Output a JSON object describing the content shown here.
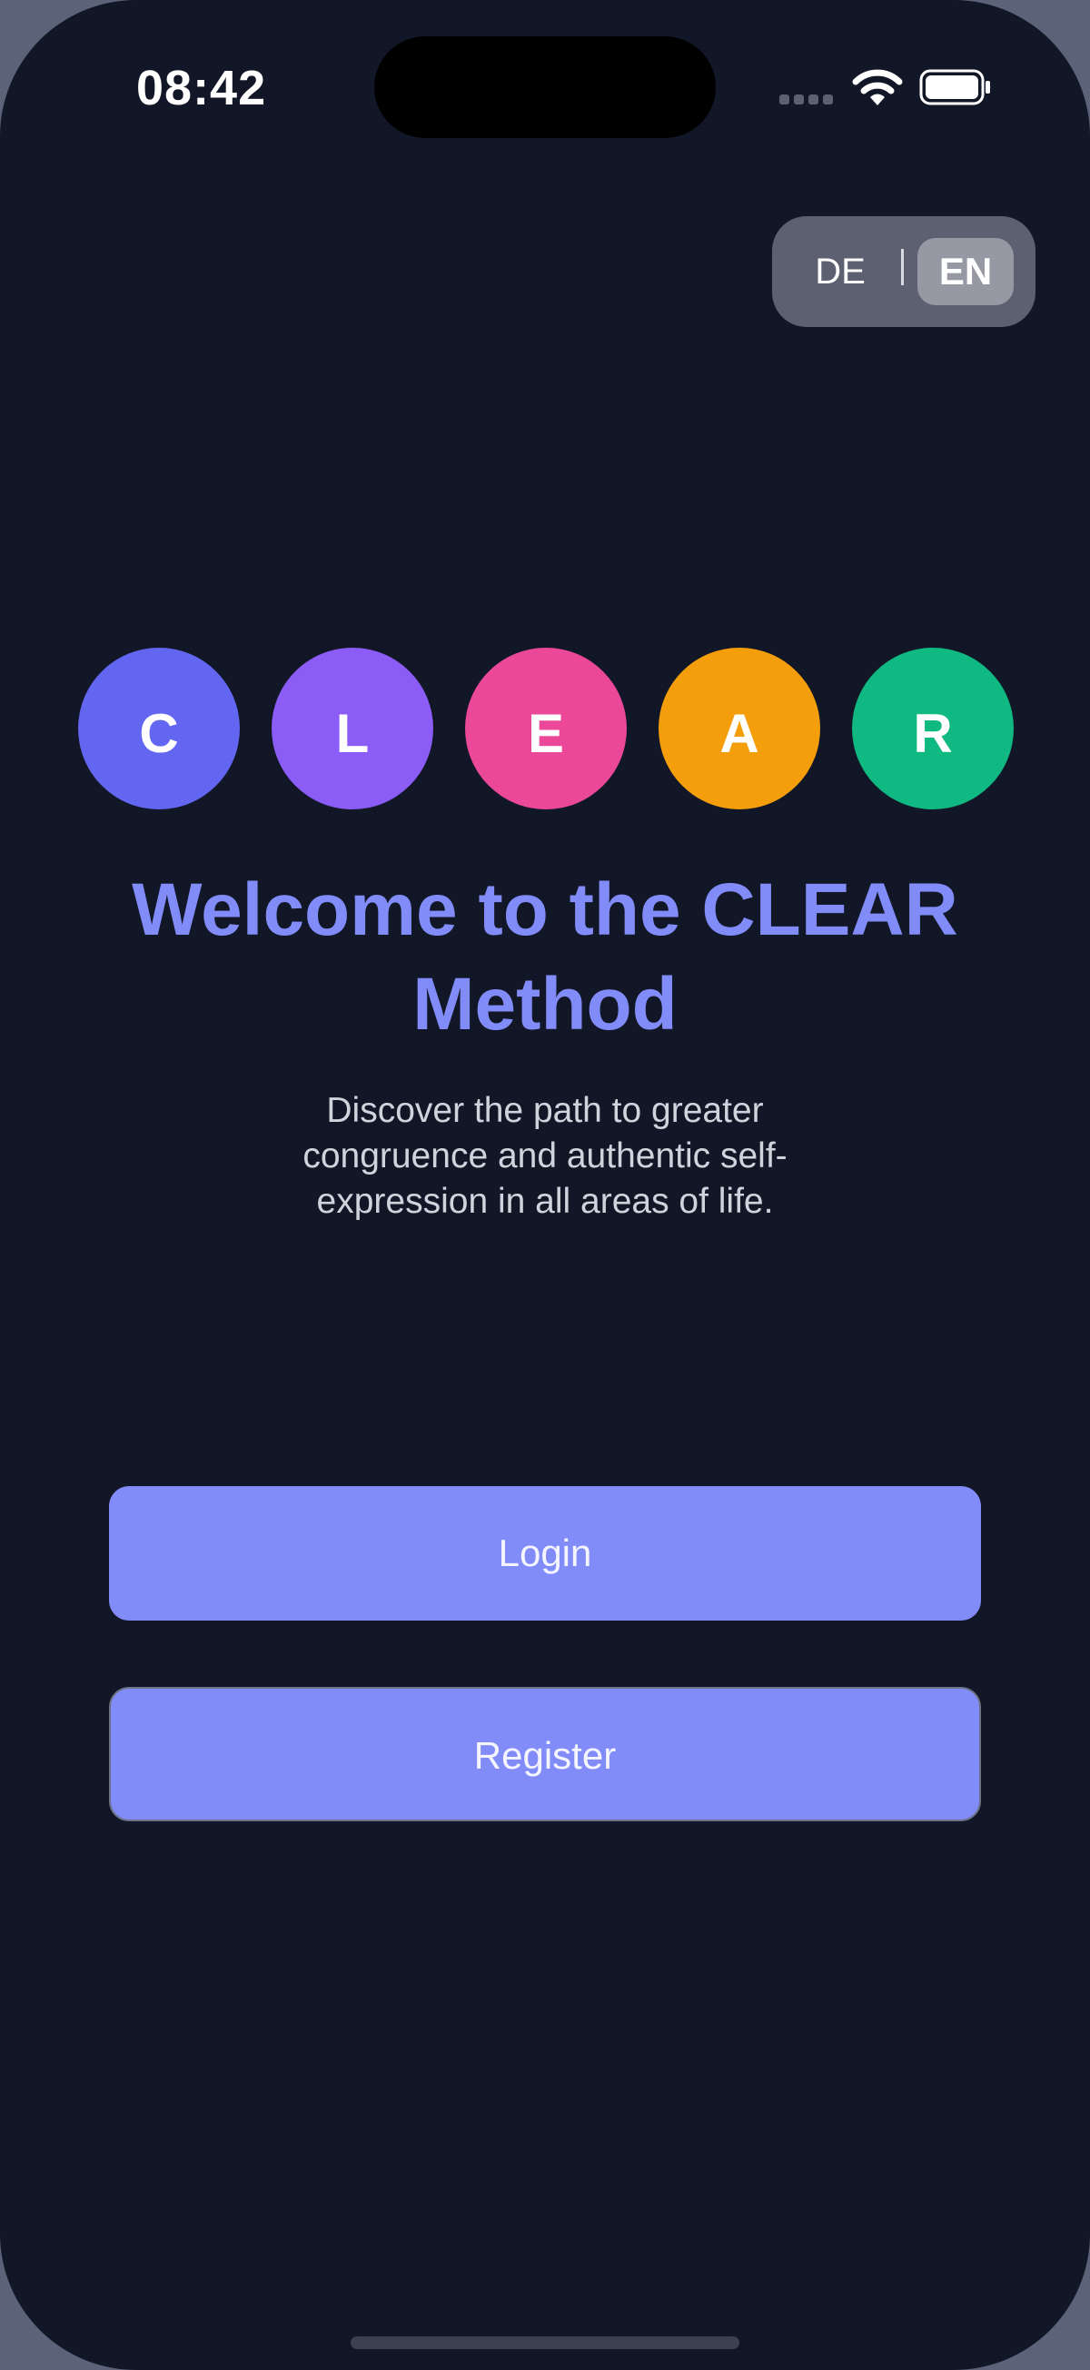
{
  "status_bar": {
    "time": "08:42"
  },
  "language_toggle": {
    "options": [
      "DE",
      "EN"
    ],
    "selected": "EN"
  },
  "logo_circles": [
    {
      "letter": "C",
      "color": "#6366f1"
    },
    {
      "letter": "L",
      "color": "#8b5cf6"
    },
    {
      "letter": "E",
      "color": "#ec4899"
    },
    {
      "letter": "A",
      "color": "#f59e0b"
    },
    {
      "letter": "R",
      "color": "#10b981"
    }
  ],
  "welcome": {
    "title_line1": "Welcome to the CLEAR",
    "title_line2": "Method",
    "subtitle_line1": "Discover the path to greater",
    "subtitle_line2": "congruence and authentic self-",
    "subtitle_line3": "expression in all areas of life."
  },
  "actions": {
    "login_label": "Login",
    "register_label": "Register"
  },
  "colors": {
    "background": "#121728",
    "accent": "#818cf8"
  }
}
